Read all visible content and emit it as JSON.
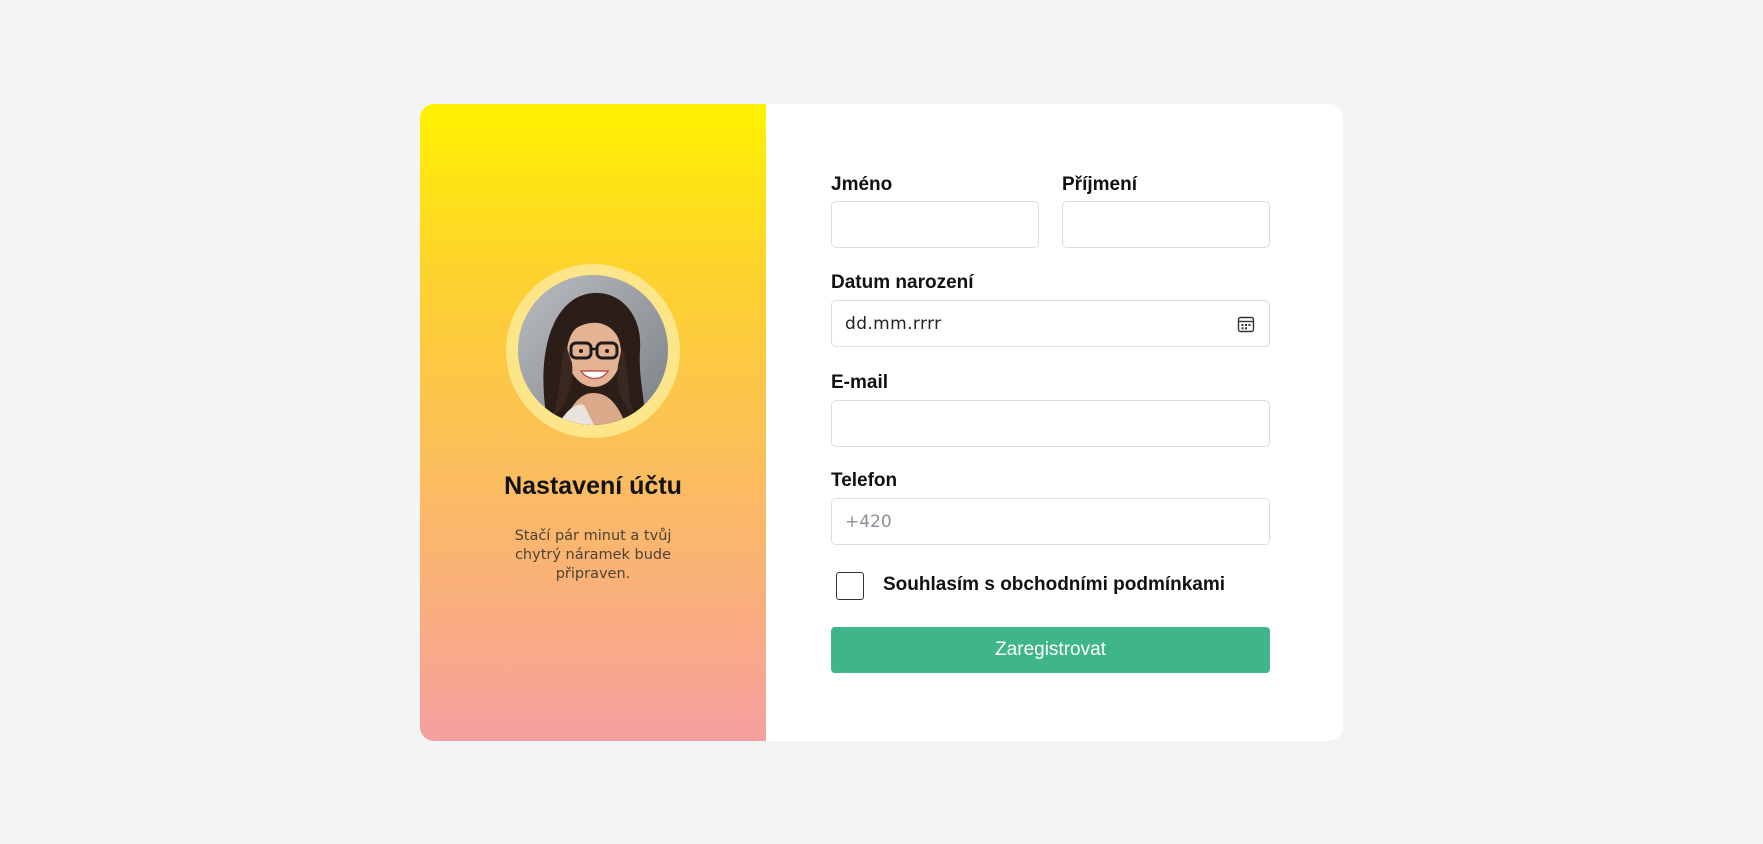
{
  "side": {
    "title": "Nastavení účtu",
    "subtitle": "Stačí pár minut a tvůj chytrý náramek bude připraven."
  },
  "form": {
    "first_name_label": "Jméno",
    "first_name_value": "",
    "last_name_label": "Příjmení",
    "last_name_value": "",
    "dob_label": "Datum narození",
    "dob_placeholder": "dd.mm.rrrr",
    "email_label": "E-mail",
    "email_value": "",
    "phone_label": "Telefon",
    "phone_placeholder": "+420",
    "terms_label": "Souhlasím s obchodními podmínkami",
    "terms_checked": false,
    "submit_label": "Zaregistrovat"
  },
  "colors": {
    "page_bg": "#f3f4f6",
    "gradient_top": "#fff200",
    "gradient_bottom": "#f5a0a0",
    "button": "#3fb68a"
  },
  "icons": {
    "date_picker": "calendar-icon"
  }
}
